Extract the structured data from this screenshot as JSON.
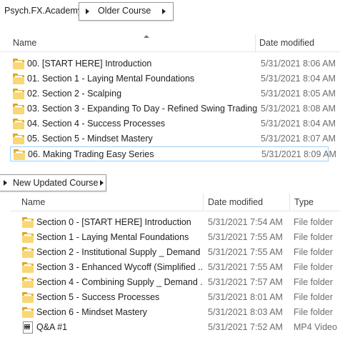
{
  "top_breadcrumb": {
    "root": "Psych.FX.Academy",
    "current": "Older Course"
  },
  "top_list": {
    "columns": {
      "name": "Name",
      "date": "Date modified"
    },
    "rows": [
      {
        "name": "00. [START HERE] Introduction",
        "date": "5/31/2021 8:06 AM",
        "selected": false
      },
      {
        "name": "01. Section 1 - Laying Mental Foundations",
        "date": "5/31/2021 8:04 AM",
        "selected": false
      },
      {
        "name": "02. Section 2 - Scalping",
        "date": "5/31/2021 8:05 AM",
        "selected": false
      },
      {
        "name": "03. Section 3 - Expanding To Day - Refined Swing Trading",
        "date": "5/31/2021 8:08 AM",
        "selected": false
      },
      {
        "name": "04. Section 4  - Success Processes",
        "date": "5/31/2021 8:04 AM",
        "selected": false
      },
      {
        "name": "05. Section 5 - Mindset Mastery",
        "date": "5/31/2021 8:07 AM",
        "selected": false
      },
      {
        "name": "06. Making Trading Easy Series",
        "date": "5/31/2021 8:09 AM",
        "selected": true
      }
    ]
  },
  "bottom_breadcrumb": {
    "current": "New Updated Course"
  },
  "bottom_list": {
    "columns": {
      "name": "Name",
      "date": "Date modified",
      "type": "Type"
    },
    "rows": [
      {
        "icon": "folder-icon",
        "name": "Section 0 - [START HERE] Introduction",
        "date": "5/31/2021 7:54 AM",
        "type": "File folder"
      },
      {
        "icon": "folder-icon",
        "name": "Section 1 - Laying Mental Foundations",
        "date": "5/31/2021 7:55 AM",
        "type": "File folder"
      },
      {
        "icon": "folder-icon",
        "name": "Section 2 - Institutional Supply _ Demand",
        "date": "5/31/2021 7:55 AM",
        "type": "File folder"
      },
      {
        "icon": "folder-icon",
        "name": "Section 3 - Enhanced Wycoff (Simplified ...",
        "date": "5/31/2021 7:55 AM",
        "type": "File folder"
      },
      {
        "icon": "folder-icon",
        "name": "Section 4 - Combining Supply _ Demand ...",
        "date": "5/31/2021 7:57 AM",
        "type": "File folder"
      },
      {
        "icon": "folder-icon",
        "name": "Section 5  - Success Processes",
        "date": "5/31/2021 8:01 AM",
        "type": "File folder"
      },
      {
        "icon": "folder-icon",
        "name": "Section 6 - Mindset Mastery",
        "date": "5/31/2021 8:03 AM",
        "type": "File folder"
      },
      {
        "icon": "video-file-icon",
        "name": "Q&A #1",
        "date": "5/31/2021 7:52 AM",
        "type": "MP4 Video"
      }
    ]
  }
}
